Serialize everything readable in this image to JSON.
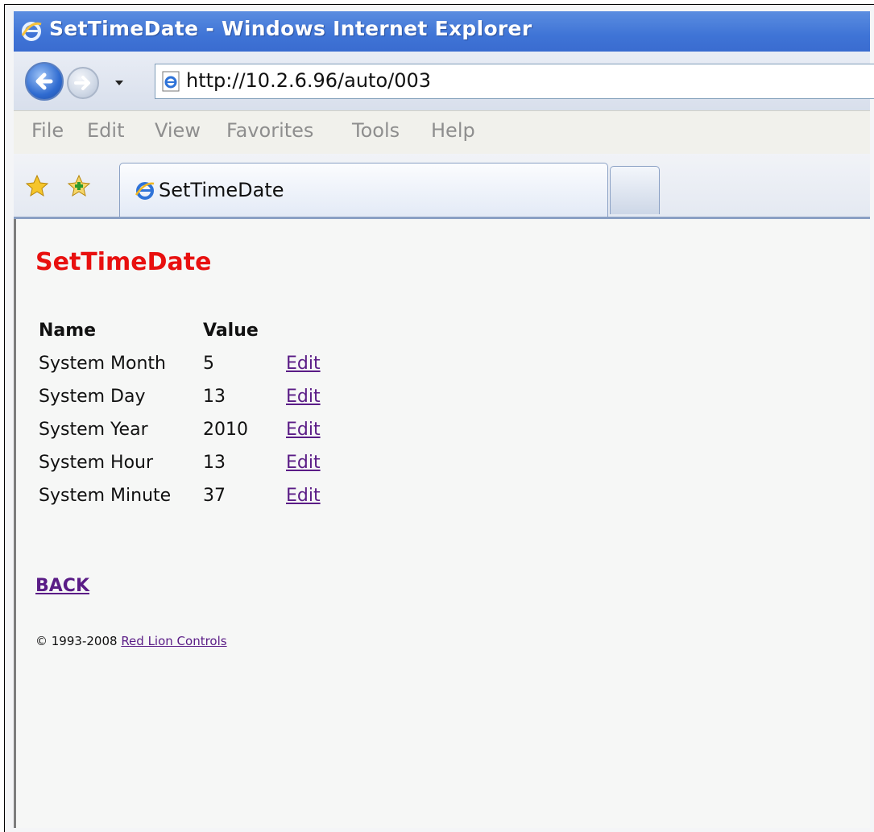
{
  "window": {
    "title": "SetTimeDate - Windows Internet Explorer",
    "title_bar_color": "#3f74d6"
  },
  "address_bar": {
    "url": "http://10.2.6.96/auto/003"
  },
  "menu": {
    "items": [
      "File",
      "Edit",
      "View",
      "Favorites",
      "Tools",
      "Help"
    ]
  },
  "tabs": {
    "active_label": "SetTimeDate"
  },
  "page": {
    "heading": "SetTimeDate",
    "heading_color": "#e8100f",
    "table": {
      "headers": [
        "Name",
        "Value"
      ],
      "rows": [
        {
          "name": "System Month",
          "value": "5",
          "action": "Edit"
        },
        {
          "name": "System Day",
          "value": "13",
          "action": "Edit"
        },
        {
          "name": "System Year",
          "value": "2010",
          "action": "Edit"
        },
        {
          "name": "System Hour",
          "value": "13",
          "action": "Edit"
        },
        {
          "name": "System Minute",
          "value": "37",
          "action": "Edit"
        }
      ]
    },
    "back_link": "BACK",
    "footer": {
      "copyright": "© 1993-2008",
      "company_link": "Red Lion Controls"
    },
    "link_color": "#5a1c86"
  },
  "icons": [
    "ie-logo-icon",
    "back-arrow-icon",
    "forward-arrow-icon",
    "dropdown-arrow-icon",
    "page-icon",
    "favorites-star-icon",
    "add-favorites-icon",
    "tab-ie-icon"
  ]
}
